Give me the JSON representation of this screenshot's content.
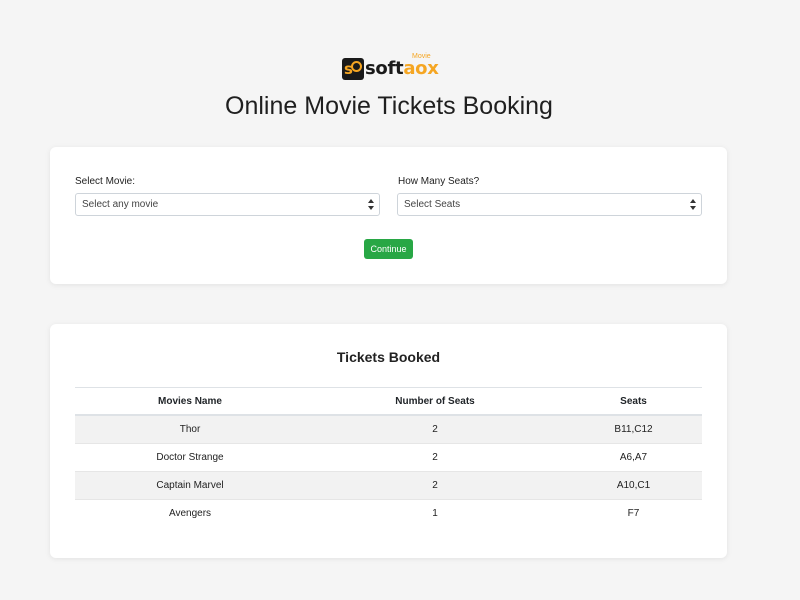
{
  "brand": {
    "text_dark": "soft",
    "text_orange": "aox",
    "tag": "Movie",
    "accent_color": "#f5a623"
  },
  "page_title": "Online Movie Tickets Booking",
  "form": {
    "movie_label": "Select Movie:",
    "movie_selected": "Select any movie",
    "seats_label": "How Many Seats?",
    "seats_selected": "Select Seats",
    "continue_label": "Continue",
    "continue_color": "#28a745"
  },
  "booked": {
    "heading": "Tickets Booked",
    "columns": [
      "Movies Name",
      "Number of Seats",
      "Seats"
    ],
    "rows": [
      [
        "Thor",
        "2",
        "B11,C12"
      ],
      [
        "Doctor Strange",
        "2",
        "A6,A7"
      ],
      [
        "Captain Marvel",
        "2",
        "A10,C1"
      ],
      [
        "Avengers",
        "1",
        "F7"
      ]
    ]
  }
}
